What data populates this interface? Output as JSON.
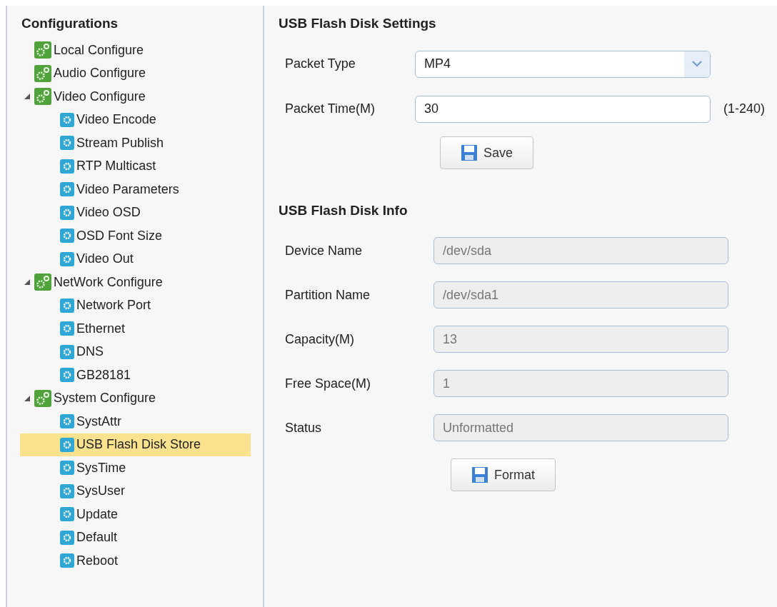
{
  "sidebar": {
    "title": "Configurations",
    "items": [
      {
        "label": "Local Configure",
        "kind": "group",
        "selected": false
      },
      {
        "label": "Audio Configure",
        "kind": "group",
        "selected": false
      },
      {
        "label": "Video Configure",
        "kind": "group",
        "selected": false,
        "expanded": true,
        "children": [
          {
            "label": "Video Encode",
            "kind": "page",
            "selected": false
          },
          {
            "label": "Stream Publish",
            "kind": "page",
            "selected": false
          },
          {
            "label": "RTP Multicast",
            "kind": "page",
            "selected": false
          },
          {
            "label": "Video Parameters",
            "kind": "page",
            "selected": false
          },
          {
            "label": "Video OSD",
            "kind": "page",
            "selected": false
          },
          {
            "label": "OSD Font Size",
            "kind": "page",
            "selected": false
          },
          {
            "label": "Video Out",
            "kind": "page",
            "selected": false
          }
        ]
      },
      {
        "label": "NetWork Configure",
        "kind": "group",
        "selected": false,
        "expanded": true,
        "children": [
          {
            "label": "Network Port",
            "kind": "page",
            "selected": false
          },
          {
            "label": "Ethernet",
            "kind": "page",
            "selected": false
          },
          {
            "label": "DNS",
            "kind": "page",
            "selected": false
          },
          {
            "label": "GB28181",
            "kind": "page",
            "selected": false
          }
        ]
      },
      {
        "label": "System Configure",
        "kind": "group",
        "selected": false,
        "expanded": true,
        "children": [
          {
            "label": "SystAttr",
            "kind": "page",
            "selected": false
          },
          {
            "label": "USB Flash Disk Store",
            "kind": "page",
            "selected": true
          },
          {
            "label": "SysTime",
            "kind": "page",
            "selected": false
          },
          {
            "label": "SysUser",
            "kind": "page",
            "selected": false
          },
          {
            "label": "Update",
            "kind": "page",
            "selected": false
          },
          {
            "label": "Default",
            "kind": "page",
            "selected": false
          },
          {
            "label": "Reboot",
            "kind": "page",
            "selected": false
          }
        ]
      }
    ]
  },
  "settings": {
    "title": "USB Flash Disk Settings",
    "fields": [
      {
        "label": "Packet Type",
        "kind": "select",
        "value": "MP4"
      },
      {
        "label": "Packet Time(M)",
        "kind": "input",
        "value": "30",
        "hint": "(1-240)"
      }
    ],
    "button": "Save"
  },
  "info": {
    "title": "USB Flash Disk Info",
    "fields": [
      {
        "label": "Device Name",
        "value": "/dev/sda",
        "disabled": true
      },
      {
        "label": "Partition Name",
        "value": "/dev/sda1",
        "disabled": true
      },
      {
        "label": "Capacity(M)",
        "value": "13",
        "disabled": true
      },
      {
        "label": "Free Space(M)",
        "value": "1",
        "disabled": true
      },
      {
        "label": "Status",
        "value": "Unformatted",
        "disabled": true
      }
    ],
    "button": "Format"
  }
}
